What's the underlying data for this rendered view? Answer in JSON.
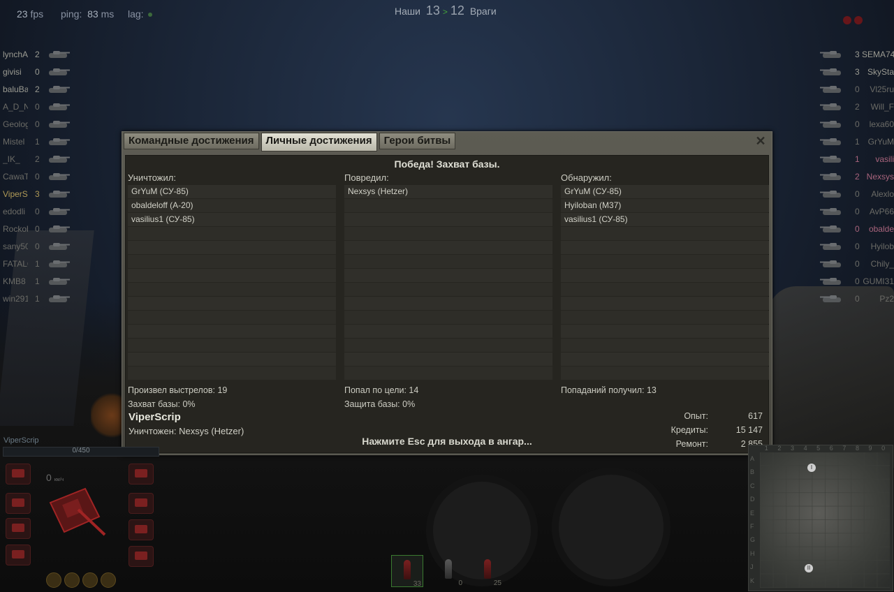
{
  "hud": {
    "fps_value": "23",
    "fps_label": "fps",
    "ping_label": "ping:",
    "ping_value": "83",
    "ping_unit": "ms",
    "lag_label": "lag:"
  },
  "score": {
    "allies_label": "Наши",
    "allies": "13",
    "separator": ">",
    "enemies": "12",
    "enemies_label": "Враги"
  },
  "team_left": [
    {
      "name": "lynchA",
      "frags": "2",
      "style": "normal"
    },
    {
      "name": "givisi",
      "frags": "0",
      "style": "normal"
    },
    {
      "name": "baluBa",
      "frags": "2",
      "style": "normal"
    },
    {
      "name": "A_D_N_",
      "frags": "0",
      "style": "dead"
    },
    {
      "name": "Geolog",
      "frags": "0",
      "style": "dead"
    },
    {
      "name": "Mistel",
      "frags": "1",
      "style": "dead"
    },
    {
      "name": "_IK_",
      "frags": "2",
      "style": "dead"
    },
    {
      "name": "CawaTa",
      "frags": "0",
      "style": "dead"
    },
    {
      "name": "ViperS",
      "frags": "3",
      "style": "gold"
    },
    {
      "name": "edodli",
      "frags": "0",
      "style": "dead"
    },
    {
      "name": "Rockob",
      "frags": "0",
      "style": "dead"
    },
    {
      "name": "sany50",
      "frags": "0",
      "style": "dead"
    },
    {
      "name": "FATALO",
      "frags": "1",
      "style": "dead"
    },
    {
      "name": "KMB8",
      "frags": "1",
      "style": "dead"
    },
    {
      "name": "win291",
      "frags": "1",
      "style": "dead"
    }
  ],
  "team_right": [
    {
      "name": "SEMA74",
      "frags": "3",
      "style": "normal"
    },
    {
      "name": "SkySta",
      "frags": "3",
      "style": "normal"
    },
    {
      "name": "Vl25ru",
      "frags": "0",
      "style": "dead"
    },
    {
      "name": "Will_F",
      "frags": "2",
      "style": "dead"
    },
    {
      "name": "lexa60",
      "frags": "0",
      "style": "dead"
    },
    {
      "name": "GrYuM",
      "frags": "1",
      "style": "dead"
    },
    {
      "name": "vasili",
      "frags": "1",
      "style": "purple"
    },
    {
      "name": "Nexsys",
      "frags": "2",
      "style": "purple"
    },
    {
      "name": "Alexlo",
      "frags": "0",
      "style": "dead"
    },
    {
      "name": "AvP66",
      "frags": "0",
      "style": "dead"
    },
    {
      "name": "obalde",
      "frags": "0",
      "style": "purple"
    },
    {
      "name": "Hyilob",
      "frags": "0",
      "style": "dead"
    },
    {
      "name": "Chily_",
      "frags": "0",
      "style": "dead"
    },
    {
      "name": "GUMI31",
      "frags": "0",
      "style": "dead"
    },
    {
      "name": "Pz2",
      "frags": "0",
      "style": "dead"
    }
  ],
  "dialog": {
    "tabs": [
      {
        "label": "Командные достижения"
      },
      {
        "label": "Личные достижения"
      },
      {
        "label": "Герои битвы"
      }
    ],
    "close": "✕",
    "result": "Победа! Захват базы.",
    "columns": [
      {
        "title": "Уничтожил:",
        "items": [
          "GrYuM (СУ-85)",
          "obaldeloff (А-20)",
          "vasilius1 (СУ-85)"
        ]
      },
      {
        "title": "Повредил:",
        "items": [
          "Nexsys (Hetzer)"
        ]
      },
      {
        "title": "Обнаружил:",
        "items": [
          "GrYuM (СУ-85)",
          "Hyiloban (M37)",
          "vasilius1 (СУ-85)"
        ]
      }
    ],
    "stats": {
      "shots": "Произвел выстрелов: 19",
      "hits": "Попал по цели: 14",
      "received": "Попаданий получил: 13",
      "capture": "Захват базы: 0%",
      "defense": "Защита базы: 0%"
    },
    "player_name": "ViperScrip",
    "killed_by": "Уничтожен: Nexsys (Hetzer)",
    "esc_hint": "Нажмите Esc для выхода в ангар...",
    "rewards": [
      {
        "label": "Опыт:",
        "value": "617"
      },
      {
        "label": "Кредиты:",
        "value": "15 147"
      },
      {
        "label": "Ремонт:",
        "value": "2 855"
      }
    ]
  },
  "vehicle_panel": {
    "player": "ViperScrip",
    "hp": "0/450",
    "speed": "0",
    "speed_unit": "км/ч"
  },
  "ammo": [
    {
      "count": "33",
      "selected": true
    },
    {
      "count": "0",
      "selected": false
    },
    {
      "count": "25",
      "selected": false
    }
  ],
  "minimap": {
    "cols": [
      "1",
      "2",
      "3",
      "4",
      "5",
      "6",
      "7",
      "8",
      "9",
      "0"
    ],
    "rows": [
      "A",
      "B",
      "C",
      "D",
      "E",
      "F",
      "G",
      "H",
      "J",
      "K"
    ],
    "base1": "I",
    "base2": "II"
  }
}
